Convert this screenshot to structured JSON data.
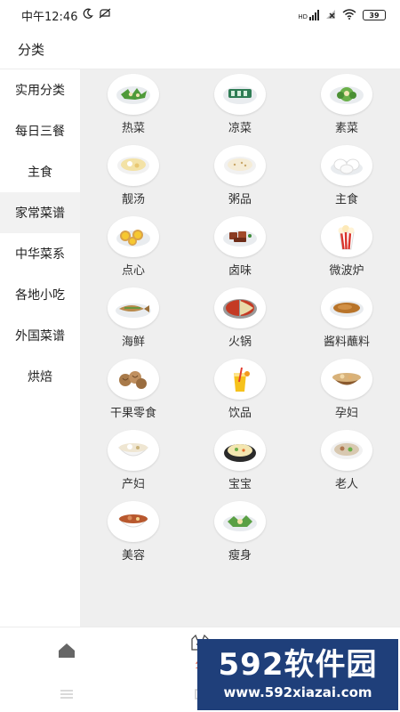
{
  "status_bar": {
    "time": "中午12:46",
    "battery": "39"
  },
  "header": {
    "title": "分类"
  },
  "sidebar": {
    "items": [
      {
        "label": "实用分类"
      },
      {
        "label": "每日三餐"
      },
      {
        "label": "主食"
      },
      {
        "label": "家常菜谱",
        "active": true
      },
      {
        "label": "中华菜系"
      },
      {
        "label": "各地小吃"
      },
      {
        "label": "外国菜谱"
      },
      {
        "label": "烘焙"
      }
    ]
  },
  "categories": [
    {
      "label": "热菜",
      "icon": "hot-dish-icon"
    },
    {
      "label": "凉菜",
      "icon": "cold-dish-icon"
    },
    {
      "label": "素菜",
      "icon": "vegetable-dish-icon"
    },
    {
      "label": "靓汤",
      "icon": "soup-icon"
    },
    {
      "label": "粥品",
      "icon": "porridge-icon"
    },
    {
      "label": "主食",
      "icon": "steamed-bun-icon"
    },
    {
      "label": "点心",
      "icon": "egg-tart-icon"
    },
    {
      "label": "卤味",
      "icon": "braised-meat-icon"
    },
    {
      "label": "微波炉",
      "icon": "popcorn-icon"
    },
    {
      "label": "海鲜",
      "icon": "fish-icon"
    },
    {
      "label": "火锅",
      "icon": "hotpot-icon"
    },
    {
      "label": "酱料蘸料",
      "icon": "sauce-icon"
    },
    {
      "label": "干果零食",
      "icon": "walnut-icon"
    },
    {
      "label": "饮品",
      "icon": "drink-icon"
    },
    {
      "label": "孕妇",
      "icon": "pregnancy-meal-icon"
    },
    {
      "label": "产妇",
      "icon": "postpartum-soup-icon"
    },
    {
      "label": "宝宝",
      "icon": "baby-food-icon"
    },
    {
      "label": "老人",
      "icon": "elder-meal-icon"
    },
    {
      "label": "美容",
      "icon": "beauty-soup-icon"
    },
    {
      "label": "瘦身",
      "icon": "slimming-icon"
    }
  ],
  "tabbar": {
    "middle_label": "分"
  },
  "watermark": {
    "big": "592软件园",
    "small": "www.592xiazai.com"
  },
  "colors": {
    "accent": "#e0583a",
    "content_bg": "#efefef",
    "sidebar_active_bg": "#f2f2f2",
    "watermark_bg": "#1f3f7a"
  }
}
